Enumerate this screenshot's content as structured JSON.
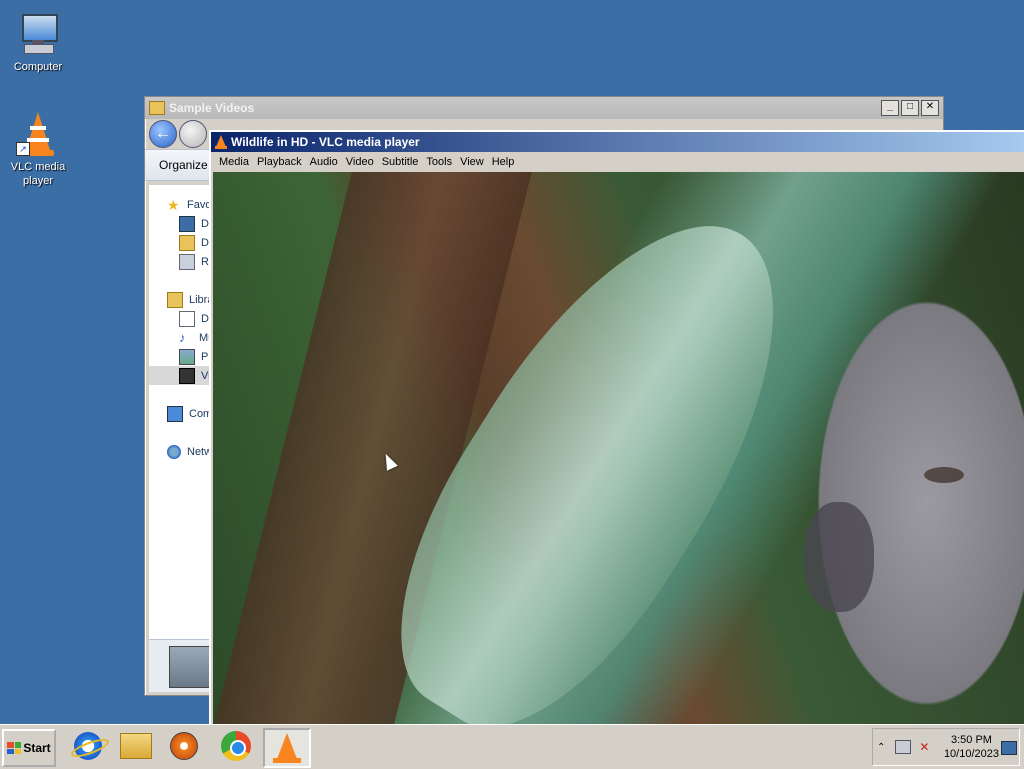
{
  "desktop": {
    "icons": [
      {
        "label": "Computer"
      },
      {
        "label": "VLC media\nplayer"
      }
    ]
  },
  "explorer": {
    "title": "Sample Videos",
    "buttons": {
      "minimize": "_",
      "maximize": "□",
      "close": "✕"
    },
    "toolbar": {
      "organize": "Organize"
    },
    "nav": {
      "favorites": "Favo",
      "desktop": "De",
      "downloads": "Do",
      "recent": "Re",
      "libraries": "Libra",
      "documents": "Do",
      "music": "Mu",
      "pictures": "Pic",
      "videos": "Vi",
      "computer": "Com",
      "network": "Netw"
    }
  },
  "vlc": {
    "title": "Wildlife in HD - VLC media player",
    "menu": [
      "Media",
      "Playback",
      "Audio",
      "Video",
      "Subtitle",
      "Tools",
      "View",
      "Help"
    ]
  },
  "taskbar": {
    "start_label": "Start",
    "apps": [
      "internet-explorer",
      "file-explorer",
      "media-player",
      "chrome",
      "vlc"
    ],
    "clock": {
      "time": "3:50 PM",
      "date": "10/10/2023"
    }
  },
  "colors": {
    "desktop": "#3a6ea5",
    "vlc_title": "#0a246a",
    "vlc_orange": "#f7841e"
  }
}
